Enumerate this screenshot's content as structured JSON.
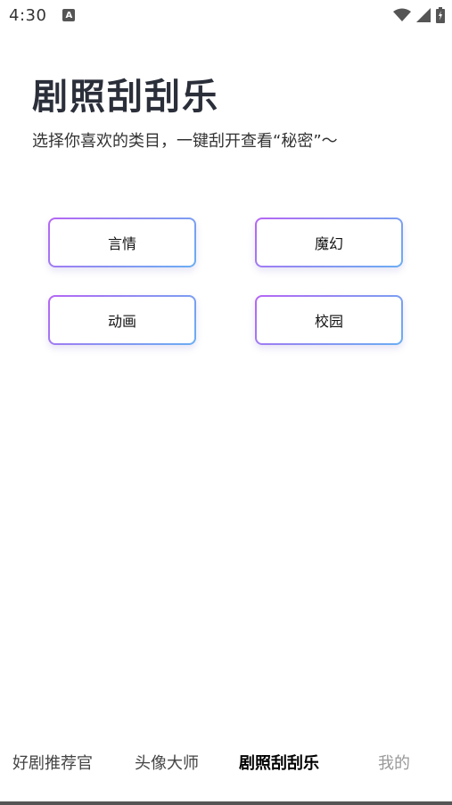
{
  "status_bar": {
    "time": "4:30",
    "notification_icon_label": "A"
  },
  "header": {
    "title": "剧照刮刮乐",
    "subtitle": "选择你喜欢的类目，一键刮开查看“秘密”～"
  },
  "categories": [
    {
      "label": "言情"
    },
    {
      "label": "魔幻"
    },
    {
      "label": "动画"
    },
    {
      "label": "校园"
    }
  ],
  "bottom_nav": [
    {
      "label": "好剧推荐官"
    },
    {
      "label": "头像大师"
    },
    {
      "label": "剧照刮刮乐"
    },
    {
      "label": "我的"
    }
  ],
  "colors": {
    "accent_gradient_start": "#b665f5",
    "accent_gradient_end": "#6aaef3",
    "title": "#2b2f3a"
  }
}
